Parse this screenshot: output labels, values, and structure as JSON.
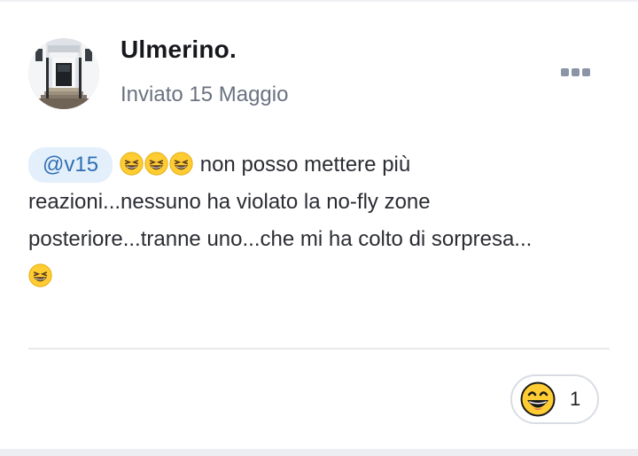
{
  "post": {
    "author_name": "Ulmerino.",
    "posted_text": "Inviato 15 Maggio",
    "mention": "@v15",
    "inline_emoji_icon": "grinning-squinting-face-icon",
    "line1_text": "non posso mettere più",
    "line2_text": "reazioni...nessuno ha violato la no-fly zone",
    "line3_text": "posteriore...tranne uno...che mi ha colto di sorpresa...",
    "more_icon": "more-options-icon"
  },
  "reactions": {
    "icon": "laughing-face-icon",
    "count": "1"
  },
  "colors": {
    "mention_bg": "#e3effb",
    "mention_text": "#2f6fb3",
    "muted_text": "#6b7280",
    "emoji_yellow": "#ffcc33"
  }
}
